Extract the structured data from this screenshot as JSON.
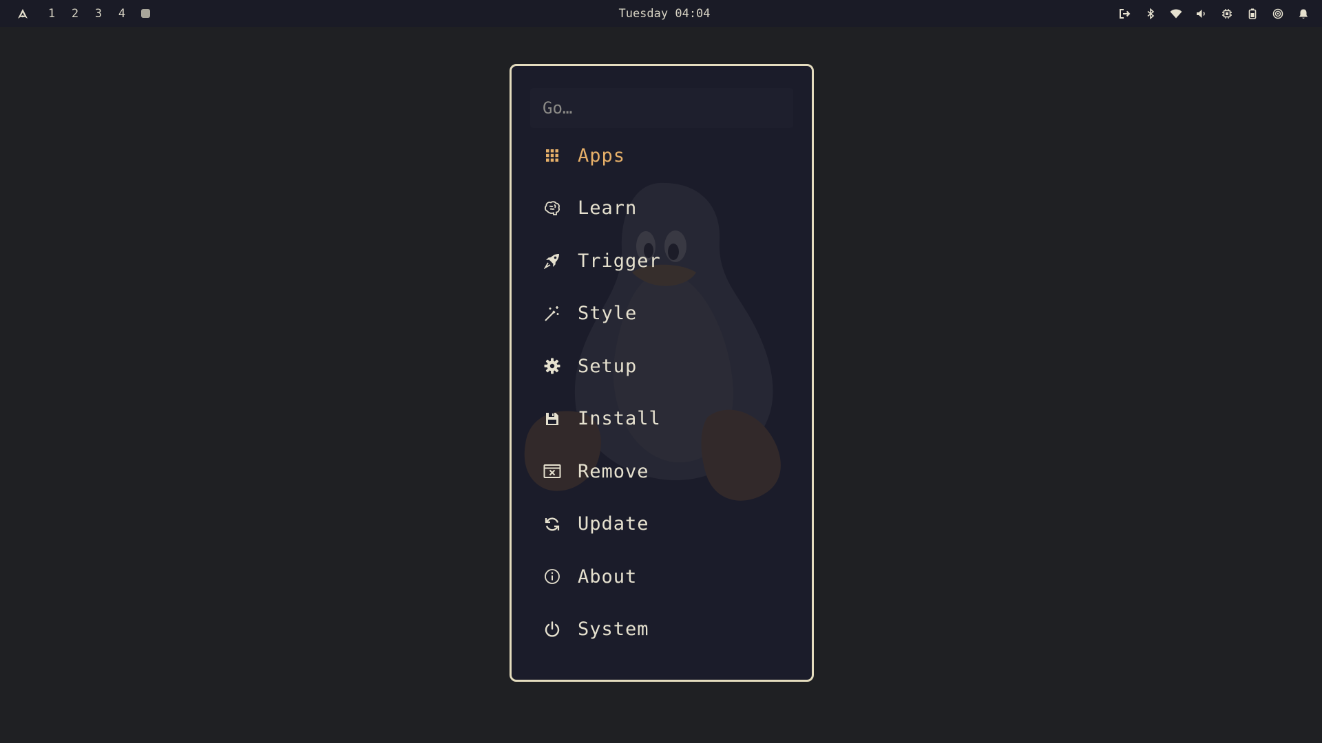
{
  "topbar": {
    "logo_icon": "arch-logo-icon",
    "workspaces": [
      "1",
      "2",
      "3",
      "4"
    ],
    "clock": "Tuesday 04:04",
    "tray_icons": [
      "logout-icon",
      "bluetooth-icon",
      "wifi-icon",
      "volume-icon",
      "cpu-icon",
      "battery-icon",
      "focus-icon",
      "bell-icon"
    ]
  },
  "launcher": {
    "search_placeholder": "Go…",
    "selected_index": 0,
    "items": [
      {
        "label": "Apps",
        "icon": "grid-icon"
      },
      {
        "label": "Learn",
        "icon": "brain-icon"
      },
      {
        "label": "Trigger",
        "icon": "rocket-icon"
      },
      {
        "label": "Style",
        "icon": "magic-wand-icon"
      },
      {
        "label": "Setup",
        "icon": "gear-icon"
      },
      {
        "label": "Install",
        "icon": "floppy-disk-icon"
      },
      {
        "label": "Remove",
        "icon": "window-close-icon"
      },
      {
        "label": "Update",
        "icon": "refresh-icon"
      },
      {
        "label": "About",
        "icon": "info-icon"
      },
      {
        "label": "System",
        "icon": "power-icon"
      }
    ]
  },
  "colors": {
    "desktop_bg": "#1f2023",
    "panel_bg": "#1b1c2a",
    "border": "#e4dcbe",
    "text": "#e6e1cf",
    "accent": "#e7b069"
  }
}
